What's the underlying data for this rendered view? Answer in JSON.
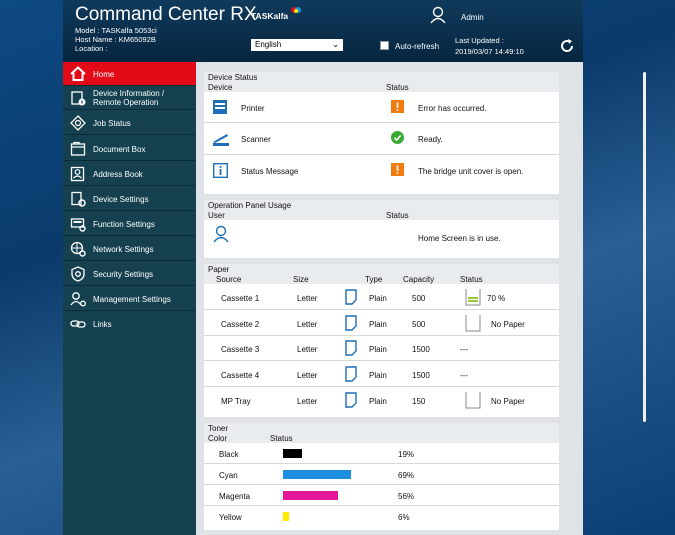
{
  "header": {
    "app_title": "Command Center RX",
    "model": "Model : TASKalfa 5053ci",
    "host_name": "Host Name : KM65092B",
    "location": "Location :",
    "brand": "TASKalfa",
    "user_name": "Admin",
    "language": "English",
    "auto_refresh_label": "Auto-refresh",
    "last_updated_label": "Last Updated :",
    "last_updated_value": "2019/03/07 14:49:10"
  },
  "sidebar": {
    "items": [
      {
        "label": "Home",
        "icon": "home-icon",
        "active": true
      },
      {
        "label": "Device Information /\nRemote Operation",
        "icon": "device-info-icon"
      },
      {
        "label": "Job Status",
        "icon": "job-status-icon"
      },
      {
        "label": "Document Box",
        "icon": "document-box-icon"
      },
      {
        "label": "Address Book",
        "icon": "address-book-icon"
      },
      {
        "label": "Device Settings",
        "icon": "device-settings-icon"
      },
      {
        "label": "Function Settings",
        "icon": "function-settings-icon"
      },
      {
        "label": "Network Settings",
        "icon": "network-settings-icon"
      },
      {
        "label": "Security Settings",
        "icon": "security-settings-icon"
      },
      {
        "label": "Management Settings",
        "icon": "management-settings-icon"
      },
      {
        "label": "Links",
        "icon": "links-icon"
      }
    ]
  },
  "device_status": {
    "title": "Device Status",
    "col_device": "Device",
    "col_status": "Status",
    "rows": [
      {
        "device": "Printer",
        "icon": "printer-icon",
        "status_icon": "warning-icon",
        "status": "Error has occurred."
      },
      {
        "device": "Scanner",
        "icon": "scanner-icon",
        "status_icon": "check-icon",
        "status": "Ready."
      },
      {
        "device": "Status Message",
        "icon": "info-icon",
        "status_icon": "warning-icon",
        "status": "The bridge unit cover is open."
      }
    ]
  },
  "operation_panel": {
    "title": "Operation Panel Usage",
    "col_user": "User",
    "col_status": "Status",
    "status": "Home Screen is in use."
  },
  "paper": {
    "title": "Paper",
    "columns": [
      "Source",
      "Size",
      "Type",
      "Capacity",
      "Status"
    ],
    "rows": [
      {
        "source": "Cassette 1",
        "size": "Letter",
        "type": "Plain",
        "capacity": "500",
        "status_icon": "tray-partial-icon",
        "status": "70 %"
      },
      {
        "source": "Cassette 2",
        "size": "Letter",
        "type": "Plain",
        "capacity": "500",
        "status_icon": "tray-empty-icon",
        "status": "No Paper"
      },
      {
        "source": "Cassette 3",
        "size": "Letter",
        "type": "Plain",
        "capacity": "1500",
        "status_icon": "",
        "status": "---"
      },
      {
        "source": "Cassette 4",
        "size": "Letter",
        "type": "Plain",
        "capacity": "1500",
        "status_icon": "",
        "status": "---"
      },
      {
        "source": "MP Tray",
        "size": "Letter",
        "type": "Plain",
        "capacity": "150",
        "status_icon": "tray-empty-icon",
        "status": "No Paper"
      }
    ]
  },
  "toner": {
    "title": "Toner",
    "col_color": "Color",
    "col_status": "Status",
    "rows": [
      {
        "color": "Black",
        "level": 19,
        "level_text": "19%",
        "hex": "#000000"
      },
      {
        "color": "Cyan",
        "level": 69,
        "level_text": "69%",
        "hex": "#1e8fe0"
      },
      {
        "color": "Magenta",
        "level": 56,
        "level_text": "56%",
        "hex": "#e5189a"
      },
      {
        "color": "Yellow",
        "level": 6,
        "level_text": "6%",
        "hex": "#ffea00"
      }
    ]
  },
  "colors": {
    "accent_red": "#e20b17",
    "sidebar_bg": "#15404f",
    "warning": "#f07c12",
    "ok": "#3aaa35",
    "icon_blue": "#1e6fb8"
  }
}
